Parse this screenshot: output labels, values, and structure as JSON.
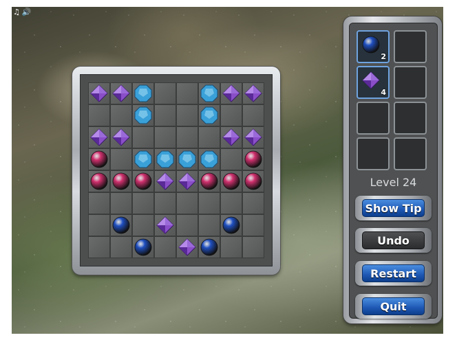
{
  "sound": {
    "music_icon": "♫",
    "speaker_icon": "🔊"
  },
  "board": {
    "rows": [
      [
        "purple",
        "purple",
        "cyan",
        "",
        "",
        "cyan",
        "purple",
        "purple"
      ],
      [
        "",
        "",
        "cyan",
        "",
        "",
        "cyan",
        "",
        ""
      ],
      [
        "purple",
        "purple",
        "",
        "",
        "",
        "",
        "purple",
        "purple"
      ],
      [
        "pink",
        "",
        "cyan",
        "cyan",
        "cyan",
        "cyan",
        "",
        "pink"
      ],
      [
        "pink",
        "pink",
        "pink",
        "purple",
        "purple",
        "pink",
        "pink",
        "pink"
      ],
      [
        "",
        "",
        "",
        "",
        "",
        "",
        "",
        ""
      ],
      [
        "",
        "blue",
        "",
        "purple",
        "",
        "",
        "blue",
        ""
      ],
      [
        "",
        "",
        "blue",
        "",
        "purple",
        "blue",
        "",
        ""
      ]
    ]
  },
  "inventory": [
    {
      "gem": "blue",
      "count": "2",
      "active": true
    },
    {
      "gem": "",
      "count": "",
      "active": false
    },
    {
      "gem": "purple",
      "count": "4",
      "active": true
    },
    {
      "gem": "",
      "count": "",
      "active": false
    },
    {
      "gem": "",
      "count": "",
      "active": false
    },
    {
      "gem": "",
      "count": "",
      "active": false
    },
    {
      "gem": "",
      "count": "",
      "active": false
    },
    {
      "gem": "",
      "count": "",
      "active": false
    }
  ],
  "level_label": "Level 24",
  "buttons": {
    "show_tip": "Show Tip",
    "undo": "Undo",
    "restart": "Restart",
    "quit": "Quit"
  },
  "colors": {
    "purple": "#8a4fc8",
    "cyan": "#3aa0d8",
    "pink": "#d0306e",
    "blue": "#1f4fc0"
  }
}
